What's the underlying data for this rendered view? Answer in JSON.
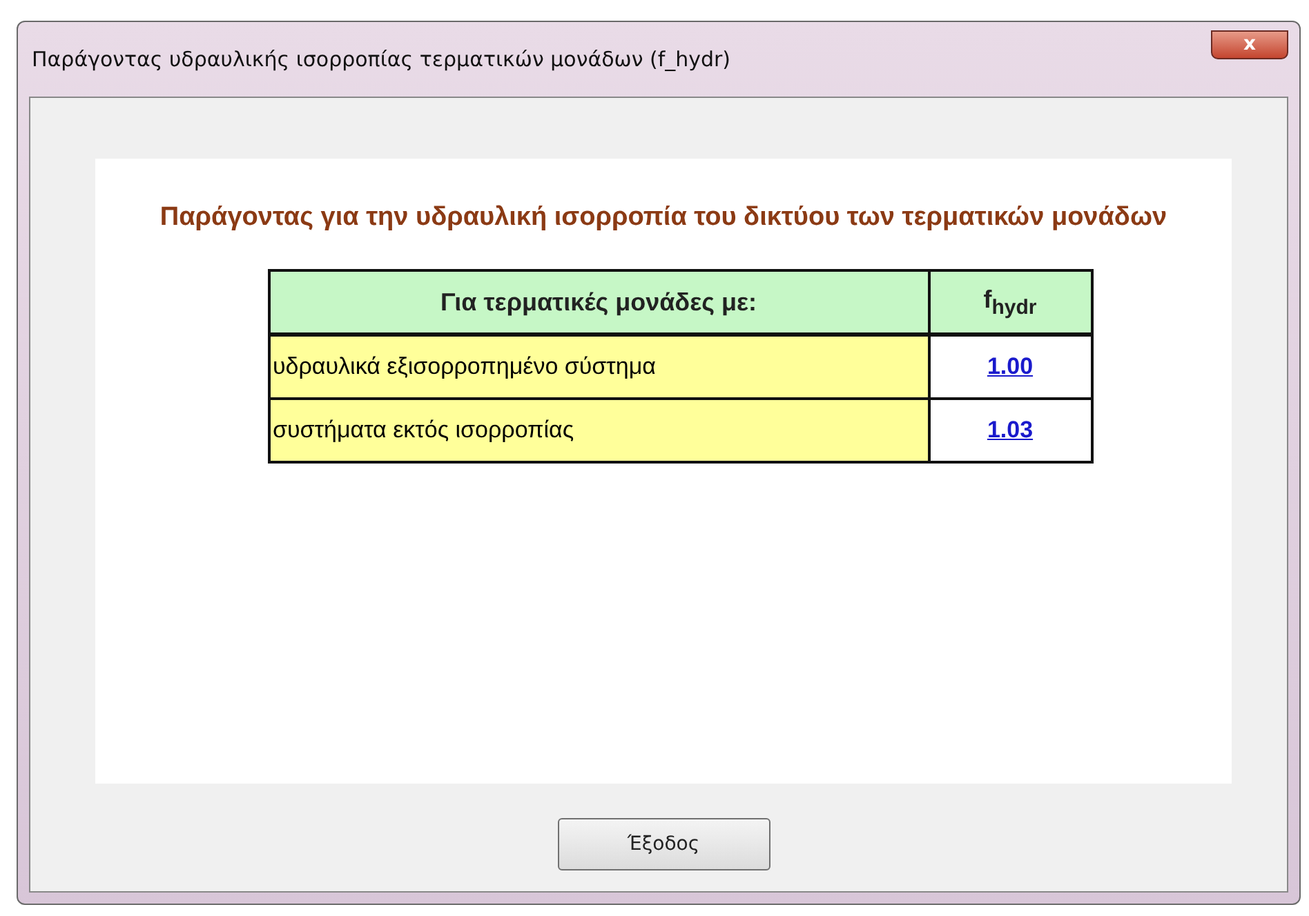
{
  "window": {
    "title": "Παράγοντας υδραυλικής ισορροπίας τερματικών μονάδων (f_hydr)",
    "close": "x"
  },
  "heading": "Παράγοντας για την υδραυλική ισορροπία του δικτύου των τερματικών μονάδων",
  "table": {
    "columns": [
      "Για τερματικές μονάδες με:",
      "f$_{hydr}$"
    ],
    "rows": [
      {
        "label": "υδραυλικά εξισορροπημένο σύστημα",
        "value": "1.00"
      },
      {
        "label": "συστήματα εκτός ισορροπίας",
        "value": "1.03"
      }
    ]
  },
  "buttons": [
    "Έξοδος"
  ]
}
